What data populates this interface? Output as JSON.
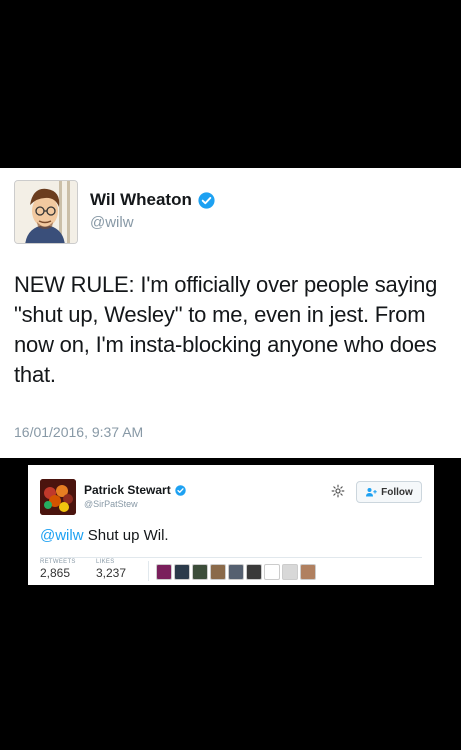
{
  "tweet_main": {
    "author_name": "Wil Wheaton",
    "handle": "@wilw",
    "text": "NEW RULE: I'm officially over people saying \"shut up, Wesley\" to me, even in jest. From now on, I'm insta-blocking anyone who does that.",
    "timestamp": "16/01/2016, 9:37 AM"
  },
  "tweet_reply": {
    "author_name": "Patrick Stewart",
    "handle": "@SirPatStew",
    "follow_label": "Follow",
    "mention": "@wilw",
    "text": " Shut up Wil.",
    "retweets_label": "RETWEETS",
    "retweets_value": "2,865",
    "likes_label": "LIKES",
    "likes_value": "3,237",
    "liker_colors": [
      "#7a1f5c",
      "#2b3a4a",
      "#3c4d3a",
      "#8a6a4a",
      "#556070",
      "#3a3a3a",
      "#ffffff",
      "#d8d8d8",
      "#b08060"
    ]
  },
  "colors": {
    "verified_blue": "#1da1f2",
    "mention_blue": "#1da1f2",
    "muted_gray": "#8899a6"
  }
}
